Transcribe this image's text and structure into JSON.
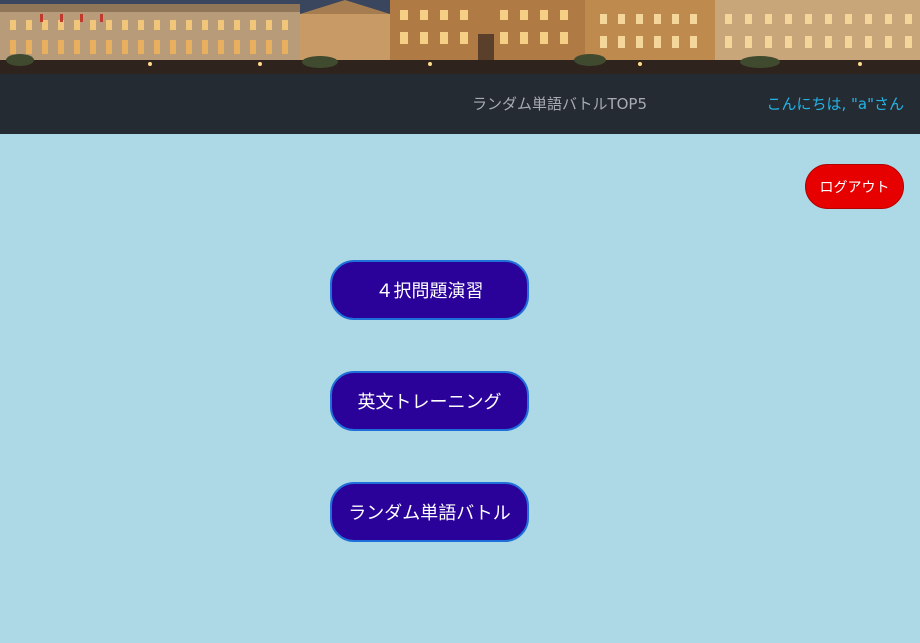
{
  "banner": {
    "image": "city-buildings-night-banner"
  },
  "navbar": {
    "top5_link": "ランダム単語バトルTOP5",
    "greeting": "こんにちは, \"a\"さん"
  },
  "actions": {
    "logout_label": "ログアウト"
  },
  "menu": {
    "items": [
      {
        "label": "４択問題演習"
      },
      {
        "label": "英文トレーニング"
      },
      {
        "label": "ランダム単語バトル"
      }
    ]
  },
  "colors": {
    "page_background": "#add8e6",
    "navbar_background": "#252b33",
    "greeting_link": "#23b4e6",
    "logout_button": "#e60000",
    "menu_button": "#2a0299",
    "menu_button_border": "#1e6fd9"
  }
}
